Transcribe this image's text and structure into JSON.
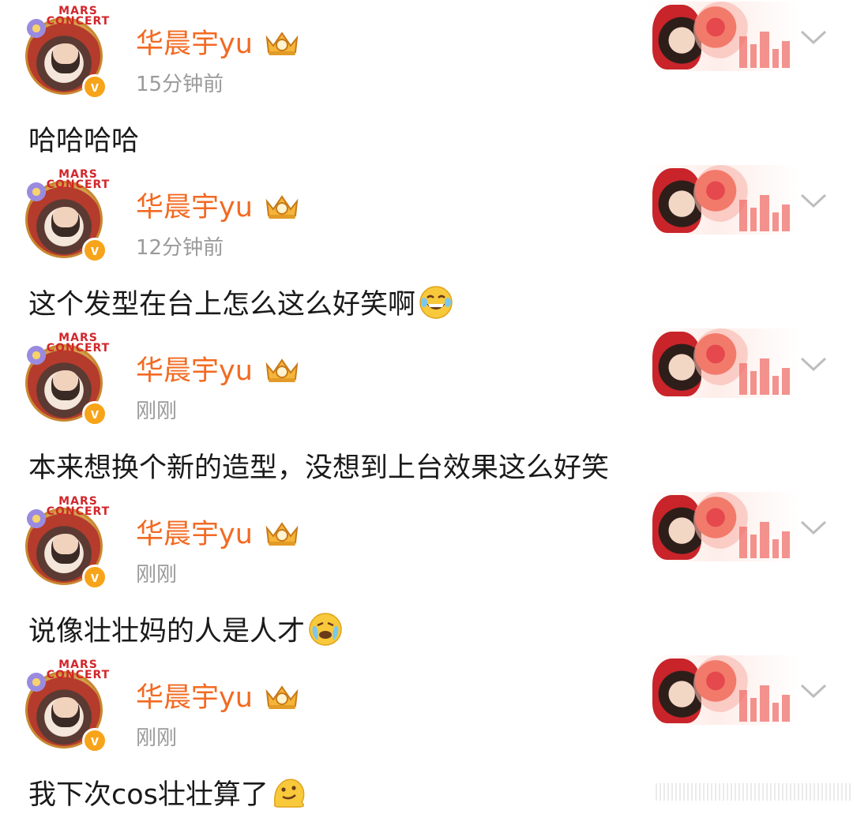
{
  "posts": [
    {
      "username": "华晨宇yu",
      "avatar_banner": "MARS CONCERT",
      "verified_glyph": "v",
      "time": "15分钟前",
      "content": "哈哈哈哈",
      "emoji": ""
    },
    {
      "username": "华晨宇yu",
      "avatar_banner": "MARS CONCERT",
      "verified_glyph": "v",
      "time": "12分钟前",
      "content": "这个发型在台上怎么这么好笑啊",
      "emoji": "laugh-cry-emoji"
    },
    {
      "username": "华晨宇yu",
      "avatar_banner": "MARS CONCERT",
      "verified_glyph": "v",
      "time": "刚刚",
      "content": "本来想换个新的造型，没想到上台效果这么好笑",
      "emoji": ""
    },
    {
      "username": "华晨宇yu",
      "avatar_banner": "MARS CONCERT",
      "verified_glyph": "v",
      "time": "刚刚",
      "content": "说像壮壮妈的人是人才",
      "emoji": "crying-laughing-emoji"
    },
    {
      "username": "华晨宇yu",
      "avatar_banner": "MARS CONCERT",
      "verified_glyph": "v",
      "time": "刚刚",
      "content": "我下次cos壮壮算了",
      "emoji": "melting-face-emoji"
    }
  ],
  "icons": {
    "crown_badge": "crown-badge-icon",
    "more": "chevron-down-icon"
  },
  "colors": {
    "username": "#f26a22",
    "time": "#9a9a9a",
    "content": "#1a1a1a",
    "verified": "#f7a41a"
  }
}
